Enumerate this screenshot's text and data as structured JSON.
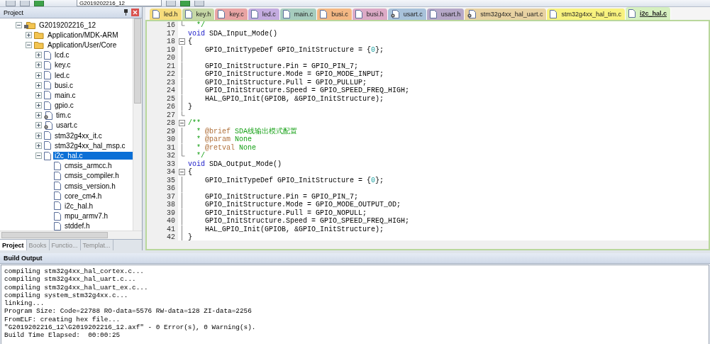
{
  "toolbar": {
    "target": "G2019202216_12"
  },
  "project_panel": {
    "title": "Project",
    "tree": [
      {
        "label": "G2019202216_12",
        "kind": "target",
        "expanded": true,
        "selected": false,
        "children": [
          {
            "label": "Application/MDK-ARM",
            "kind": "folder",
            "expanded": false,
            "selected": false
          },
          {
            "label": "Application/User/Core",
            "kind": "folder",
            "expanded": true,
            "selected": false,
            "children": [
              {
                "label": "lcd.c",
                "kind": "file",
                "expanded": false,
                "selected": false
              },
              {
                "label": "key.c",
                "kind": "file",
                "expanded": false,
                "selected": false
              },
              {
                "label": "led.c",
                "kind": "file",
                "expanded": false,
                "selected": false
              },
              {
                "label": "busi.c",
                "kind": "file",
                "expanded": false,
                "selected": false
              },
              {
                "label": "main.c",
                "kind": "file",
                "expanded": false,
                "selected": false
              },
              {
                "label": "gpio.c",
                "kind": "file",
                "expanded": false,
                "selected": false
              },
              {
                "label": "tim.c",
                "kind": "file-gear",
                "expanded": false,
                "selected": false
              },
              {
                "label": "usart.c",
                "kind": "file-gear",
                "expanded": false,
                "selected": false
              },
              {
                "label": "stm32g4xx_it.c",
                "kind": "file",
                "expanded": false,
                "selected": false
              },
              {
                "label": "stm32g4xx_hal_msp.c",
                "kind": "file",
                "expanded": false,
                "selected": false
              },
              {
                "label": "i2c_hal.c",
                "kind": "file",
                "expanded": true,
                "selected": true,
                "children": [
                  {
                    "label": "cmsis_armcc.h",
                    "kind": "header",
                    "selected": false
                  },
                  {
                    "label": "cmsis_compiler.h",
                    "kind": "header",
                    "selected": false
                  },
                  {
                    "label": "cmsis_version.h",
                    "kind": "header",
                    "selected": false
                  },
                  {
                    "label": "core_cm4.h",
                    "kind": "header",
                    "selected": false
                  },
                  {
                    "label": "i2c_hal.h",
                    "kind": "header",
                    "selected": false
                  },
                  {
                    "label": "mpu_armv7.h",
                    "kind": "header",
                    "selected": false
                  },
                  {
                    "label": "stddef.h",
                    "kind": "header",
                    "selected": false
                  }
                ]
              }
            ]
          }
        ]
      }
    ],
    "tabs": [
      {
        "label": "Project",
        "selected": true
      },
      {
        "label": "Books",
        "selected": false
      },
      {
        "label": "Functio...",
        "selected": false
      },
      {
        "label": "Templat...",
        "selected": false
      }
    ]
  },
  "editor": {
    "tabs": [
      {
        "label": "led.h",
        "kind": "file",
        "color": "#f6dc7c",
        "selected": false
      },
      {
        "label": "key.h",
        "kind": "file",
        "color": "#c6d8a6",
        "selected": false
      },
      {
        "label": "key.c",
        "kind": "file",
        "color": "#e9a4a4",
        "selected": false
      },
      {
        "label": "led.c",
        "kind": "file",
        "color": "#c4ace0",
        "selected": false
      },
      {
        "label": "main.c",
        "kind": "file",
        "color": "#a6ccbe",
        "selected": false
      },
      {
        "label": "busi.c",
        "kind": "file",
        "color": "#f4b884",
        "selected": false
      },
      {
        "label": "busi.h",
        "kind": "file",
        "color": "#dcaac6",
        "selected": false
      },
      {
        "label": "usart.c",
        "kind": "file-gear",
        "color": "#a8c2da",
        "selected": false
      },
      {
        "label": "usart.h",
        "kind": "file",
        "color": "#b6a8c8",
        "selected": false
      },
      {
        "label": "stm32g4xx_hal_uart.c",
        "kind": "file-gear",
        "color": "#e8d2a2",
        "selected": false
      },
      {
        "label": "stm32g4xx_hal_tim.c",
        "kind": "file",
        "color": "#f8f27e",
        "selected": false
      },
      {
        "label": "i2c_hal.c",
        "kind": "file",
        "color": "#d6f0c0",
        "selected": true
      }
    ],
    "lines": [
      {
        "number": "16",
        "kind": "fold-end",
        "segments": [
          {
            "kind": "comment",
            "text": "  */"
          }
        ]
      },
      {
        "number": "17",
        "kind": "plain",
        "segments": [
          {
            "kind": "keyword",
            "text": "void"
          },
          {
            "kind": "plain",
            "text": " SDA_Input_Mode()"
          }
        ]
      },
      {
        "number": "18",
        "kind": "fold-start",
        "segments": [
          {
            "kind": "plain",
            "text": "{"
          }
        ]
      },
      {
        "number": "19",
        "kind": "fold-mid",
        "segments": [
          {
            "kind": "plain",
            "text": "    GPIO_InitTypeDef GPIO_InitStructure = {"
          },
          {
            "kind": "number",
            "text": "0"
          },
          {
            "kind": "plain",
            "text": "};"
          }
        ]
      },
      {
        "number": "20",
        "kind": "fold-mid"
      },
      {
        "number": "21",
        "kind": "fold-mid",
        "segments": [
          {
            "kind": "plain",
            "text": "    GPIO_InitStructure.Pin = GPIO_PIN_7;"
          }
        ]
      },
      {
        "number": "22",
        "kind": "fold-mid",
        "segments": [
          {
            "kind": "plain",
            "text": "    GPIO_InitStructure.Mode = GPIO_MODE_INPUT;"
          }
        ]
      },
      {
        "number": "23",
        "kind": "fold-mid",
        "segments": [
          {
            "kind": "plain",
            "text": "    GPIO_InitStructure.Pull = GPIO_PULLUP;"
          }
        ]
      },
      {
        "number": "24",
        "kind": "fold-mid",
        "segments": [
          {
            "kind": "plain",
            "text": "    GPIO_InitStructure.Speed = GPIO_SPEED_FREQ_HIGH;"
          }
        ]
      },
      {
        "number": "25",
        "kind": "fold-mid",
        "segments": [
          {
            "kind": "plain",
            "text": "    HAL_GPIO_Init(GPIOB, &GPIO_InitStructure);"
          }
        ]
      },
      {
        "number": "26",
        "kind": "fold-mid",
        "segments": [
          {
            "kind": "plain",
            "text": "}"
          }
        ]
      },
      {
        "number": "27",
        "kind": "fold-end"
      },
      {
        "number": "28",
        "kind": "fold-start",
        "segments": [
          {
            "kind": "comment",
            "text": "/**"
          }
        ]
      },
      {
        "number": "29",
        "kind": "fold-mid",
        "segments": [
          {
            "kind": "comment",
            "text": "  * "
          },
          {
            "kind": "doc-tag",
            "text": "@brief"
          },
          {
            "kind": "comment",
            "text": " SDA线输出模式配置"
          }
        ]
      },
      {
        "number": "30",
        "kind": "fold-mid",
        "segments": [
          {
            "kind": "comment",
            "text": "  * "
          },
          {
            "kind": "doc-tag",
            "text": "@param"
          },
          {
            "kind": "comment",
            "text": " None"
          }
        ]
      },
      {
        "number": "31",
        "kind": "fold-mid",
        "segments": [
          {
            "kind": "comment",
            "text": "  * "
          },
          {
            "kind": "doc-tag",
            "text": "@retval"
          },
          {
            "kind": "comment",
            "text": " None"
          }
        ]
      },
      {
        "number": "32",
        "kind": "fold-end",
        "segments": [
          {
            "kind": "comment",
            "text": "  */"
          }
        ]
      },
      {
        "number": "33",
        "kind": "plain",
        "segments": [
          {
            "kind": "keyword",
            "text": "void"
          },
          {
            "kind": "plain",
            "text": " SDA_Output_Mode()"
          }
        ]
      },
      {
        "number": "34",
        "kind": "fold-start",
        "segments": [
          {
            "kind": "plain",
            "text": "{"
          }
        ]
      },
      {
        "number": "35",
        "kind": "fold-mid",
        "segments": [
          {
            "kind": "plain",
            "text": "    GPIO_InitTypeDef GPIO_InitStructure = {"
          },
          {
            "kind": "number",
            "text": "0"
          },
          {
            "kind": "plain",
            "text": "};"
          }
        ]
      },
      {
        "number": "36",
        "kind": "fold-mid"
      },
      {
        "number": "37",
        "kind": "fold-mid",
        "segments": [
          {
            "kind": "plain",
            "text": "    GPIO_InitStructure.Pin = GPIO_PIN_7;"
          }
        ]
      },
      {
        "number": "38",
        "kind": "fold-mid",
        "segments": [
          {
            "kind": "plain",
            "text": "    GPIO_InitStructure.Mode = GPIO_MODE_OUTPUT_OD;"
          }
        ]
      },
      {
        "number": "39",
        "kind": "fold-mid",
        "segments": [
          {
            "kind": "plain",
            "text": "    GPIO_InitStructure.Pull = GPIO_NOPULL;"
          }
        ]
      },
      {
        "number": "40",
        "kind": "fold-mid",
        "segments": [
          {
            "kind": "plain",
            "text": "    GPIO_InitStructure.Speed = GPIO_SPEED_FREQ_HIGH;"
          }
        ]
      },
      {
        "number": "41",
        "kind": "fold-mid",
        "segments": [
          {
            "kind": "plain",
            "text": "    HAL_GPIO_Init(GPIOB, &GPIO_InitStructure);"
          }
        ]
      },
      {
        "number": "42",
        "kind": "fold-mid",
        "segments": [
          {
            "kind": "plain",
            "text": "}"
          }
        ]
      }
    ]
  },
  "build_output": {
    "title": "Build Output",
    "lines": [
      "compiling stm32g4xx_hal_cortex.c...",
      "compiling stm32g4xx_hal_uart.c...",
      "compiling stm32g4xx_hal_uart_ex.c...",
      "compiling system_stm32g4xx.c...",
      "linking...",
      "Program Size: Code=22788 RO-data=5576 RW-data=128 ZI-data=2256",
      "FromELF: creating hex file...",
      "\"G2019202216_12\\G2019202216_12.axf\" - 0 Error(s), 0 Warning(s).",
      "Build Time Elapsed:  00:00:25"
    ]
  }
}
